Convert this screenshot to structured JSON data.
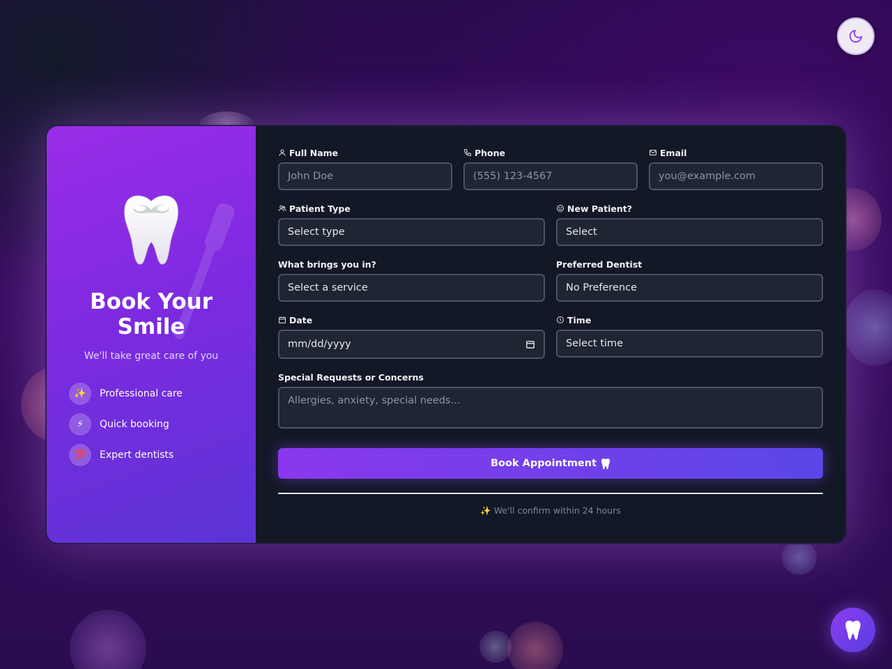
{
  "theme_toggle": {
    "icon": "moon-icon"
  },
  "fab": {
    "icon": "tooth-icon"
  },
  "hero": {
    "title": "Book Your Smile",
    "tagline": "We'll take great care of you",
    "features": [
      {
        "icon": "sparkles-icon",
        "glyph": "✨",
        "label": "Professional care"
      },
      {
        "icon": "lightning-icon",
        "glyph": "⚡",
        "label": "Quick booking"
      },
      {
        "icon": "hundred-icon",
        "glyph": "💯",
        "label": "Expert dentists"
      }
    ]
  },
  "form": {
    "full_name": {
      "label": "Full Name",
      "placeholder": "John Doe"
    },
    "phone": {
      "label": "Phone",
      "placeholder": "(555) 123-4567"
    },
    "email": {
      "label": "Email",
      "placeholder": "you@example.com"
    },
    "patient_type": {
      "label": "Patient Type",
      "value": "Select type"
    },
    "new_patient": {
      "label": "New Patient?",
      "value": "Select"
    },
    "service": {
      "label": "What brings you in?",
      "value": "Select a service"
    },
    "dentist": {
      "label": "Preferred Dentist",
      "value": "No Preference"
    },
    "date": {
      "label": "Date",
      "value": "mm/dd/yyyy"
    },
    "time": {
      "label": "Time",
      "value": "Select time"
    },
    "requests": {
      "label": "Special Requests or Concerns",
      "placeholder": "Allergies, anxiety, special needs..."
    },
    "submit_label": "Book Appointment",
    "confirm_text": "✨ We'll confirm within 24 hours"
  },
  "colors": {
    "accent_start": "#8a38ec",
    "accent_end": "#5a47e6",
    "panel_bg": "#121826",
    "input_bg": "#1e2533"
  }
}
